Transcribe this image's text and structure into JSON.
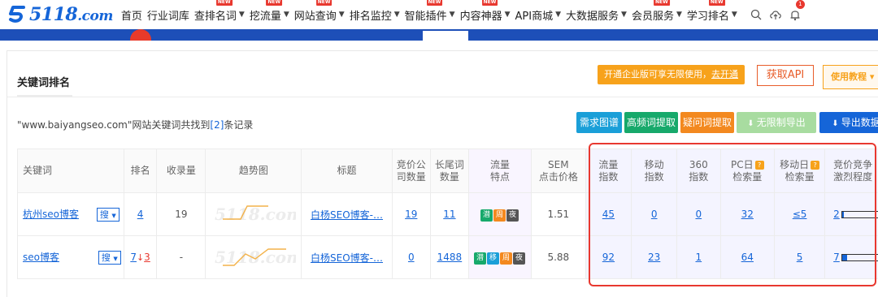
{
  "nav": {
    "logo_text": "5118",
    "logo_suffix": ".com",
    "items": [
      {
        "label": "首页",
        "caret": false,
        "badge": ""
      },
      {
        "label": "行业词库",
        "caret": false,
        "badge": ""
      },
      {
        "label": "查排名词",
        "caret": true,
        "badge": "NEW"
      },
      {
        "label": "挖流量",
        "caret": true,
        "badge": "NEW"
      },
      {
        "label": "网站查询",
        "caret": true,
        "badge": "NEW"
      },
      {
        "label": "排名监控",
        "caret": true,
        "badge": ""
      },
      {
        "label": "智能插件",
        "caret": true,
        "badge": "NEW"
      },
      {
        "label": "内容神器",
        "caret": true,
        "badge": "NEW"
      },
      {
        "label": "API商城",
        "caret": true,
        "badge": ""
      },
      {
        "label": "大数据服务",
        "caret": true,
        "badge": ""
      },
      {
        "label": "会员服务",
        "caret": true,
        "badge": "NEW"
      },
      {
        "label": "学习排名",
        "caret": true,
        "badge": "NEW"
      }
    ],
    "notif_count": "1"
  },
  "panel": {
    "title": "关键词排名",
    "promo_text": "开通企业版可享无限使用，",
    "promo_link": "去开通",
    "api_button": "获取API",
    "help_button": "使用教程",
    "help_caret": "▾",
    "count_site": "\"www.baiyangseo.com\"",
    "count_mid": "网站关键词共找到",
    "count_num": "[2]",
    "count_tail": "条记录"
  },
  "toolbar": [
    {
      "label": "需求图谱",
      "color": "#1a9fd8"
    },
    {
      "label": "高频词提取",
      "color": "#17a96b"
    },
    {
      "label": "疑问词提取",
      "color": "#f3891f"
    },
    {
      "label": "无限制导出",
      "color": "#a8dca0"
    },
    {
      "label": "导出数据",
      "color": "#1565d8"
    }
  ],
  "table": {
    "headers": {
      "keyword": "关键词",
      "rank": "排名",
      "indexed": "收录量",
      "trend": "趋势图",
      "title": "标题",
      "bid_count_1": "竞价公",
      "bid_count_2": "司数量",
      "longtail_1": "长尾词",
      "longtail_2": "数量",
      "traffic_1": "流量",
      "traffic_2": "特点",
      "sem_1": "SEM",
      "sem_2": "点击价格",
      "flow_1": "流量",
      "flow_2": "指数",
      "mobile_1": "移动",
      "mobile_2": "指数",
      "s360_1": "360",
      "s360_2": "指数",
      "pc_1": "PC日",
      "pc_2": "检索量",
      "mday_1": "移动日",
      "mday_2": "检索量",
      "comp_1": "竞价竞争",
      "comp_2": "激烈程度"
    },
    "sou_label": "搜",
    "rows": [
      {
        "keyword": "杭州seo博客",
        "rank": "4",
        "rank_change": "",
        "indexed": "19",
        "title": "白杨SEO博客-…",
        "bid_count": "19",
        "longtail": "11",
        "tags": [
          {
            "t": "潜",
            "c": "#17a96b"
          },
          {
            "t": "周",
            "c": "#f3891f"
          },
          {
            "t": "夜",
            "c": "#555555"
          }
        ],
        "sem": "1.51",
        "flow": "45",
        "mobile": "0",
        "s360": "0",
        "pc": "32",
        "mday": "≤5",
        "comp": "2",
        "comp_level": 0.04
      },
      {
        "keyword": "seo博客",
        "rank": "7",
        "rank_change": "3",
        "indexed": "-",
        "title": "白杨SEO博客-…",
        "bid_count": "0",
        "longtail": "1488",
        "tags": [
          {
            "t": "潜",
            "c": "#17a96b"
          },
          {
            "t": "移",
            "c": "#1a9fd8"
          },
          {
            "t": "周",
            "c": "#f3891f"
          },
          {
            "t": "夜",
            "c": "#555555"
          }
        ],
        "sem": "5.88",
        "flow": "92",
        "mobile": "23",
        "s360": "1",
        "pc": "64",
        "mday": "5",
        "comp": "7",
        "comp_level": 0.15
      }
    ]
  }
}
